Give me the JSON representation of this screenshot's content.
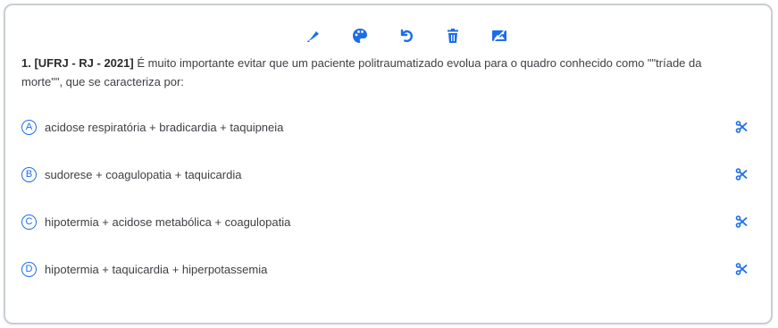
{
  "toolbar": {
    "icons": [
      "highlighter-icon",
      "palette-icon",
      "undo-icon",
      "trash-icon",
      "image-icon"
    ],
    "accent": "#1c6ee8"
  },
  "question": {
    "number_source": "1. [UFRJ - RJ - 2021]",
    "text": " É muito importante evitar que um paciente politraumatizado evolua para o quadro conhecido como \"\"tríade da morte\"\", que se caracteriza por:"
  },
  "options": [
    {
      "letter": "A",
      "text": "acidose respiratória + bradicardia + taquipneia"
    },
    {
      "letter": "B",
      "text": "sudorese + coagulopatia + taquicardia"
    },
    {
      "letter": "C",
      "text": "hipotermia + acidose metabólica + coagulopatia"
    },
    {
      "letter": "D",
      "text": "hipotermia + taquicardia + hiperpotassemia"
    }
  ],
  "option_action_icon": "scissors-icon"
}
